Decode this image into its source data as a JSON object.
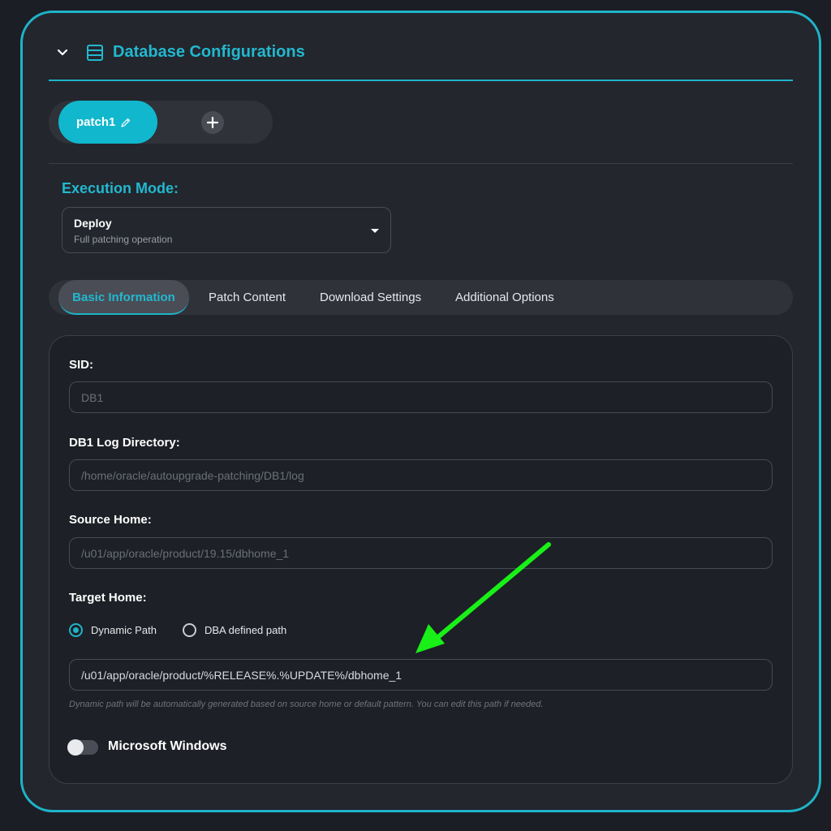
{
  "colors": {
    "accent": "#1fb3c9",
    "annotation_arrow": "#18f018"
  },
  "header": {
    "title": "Database Configurations",
    "collapse_icon": "chevron-down-icon",
    "icon": "database-icon"
  },
  "patch_tabs": {
    "active_label": "patch1",
    "edit_icon": "pencil-icon",
    "add_icon": "plus-icon"
  },
  "execution": {
    "label": "Execution Mode:",
    "mode": "Deploy",
    "description": "Full patching operation"
  },
  "tabs": [
    "Basic Information",
    "Patch Content",
    "Download Settings",
    "Additional Options"
  ],
  "form": {
    "sid": {
      "label": "SID:",
      "placeholder": "DB1"
    },
    "log_dir": {
      "label": "DB1 Log Directory:",
      "placeholder": "/home/oracle/autoupgrade-patching/DB1/log"
    },
    "source_home": {
      "label": "Source Home:",
      "placeholder": "/u01/app/oracle/product/19.15/dbhome_1"
    },
    "target_home": {
      "label": "Target Home:",
      "options": [
        "Dynamic Path",
        "DBA defined path"
      ],
      "selected": "Dynamic Path",
      "value": "/u01/app/oracle/product/%RELEASE%.%UPDATE%/dbhome_1",
      "hint": "Dynamic path will be automatically generated based on source home or default pattern. You can edit this path if needed."
    },
    "windows_toggle": {
      "label": "Microsoft Windows",
      "on": false
    }
  }
}
